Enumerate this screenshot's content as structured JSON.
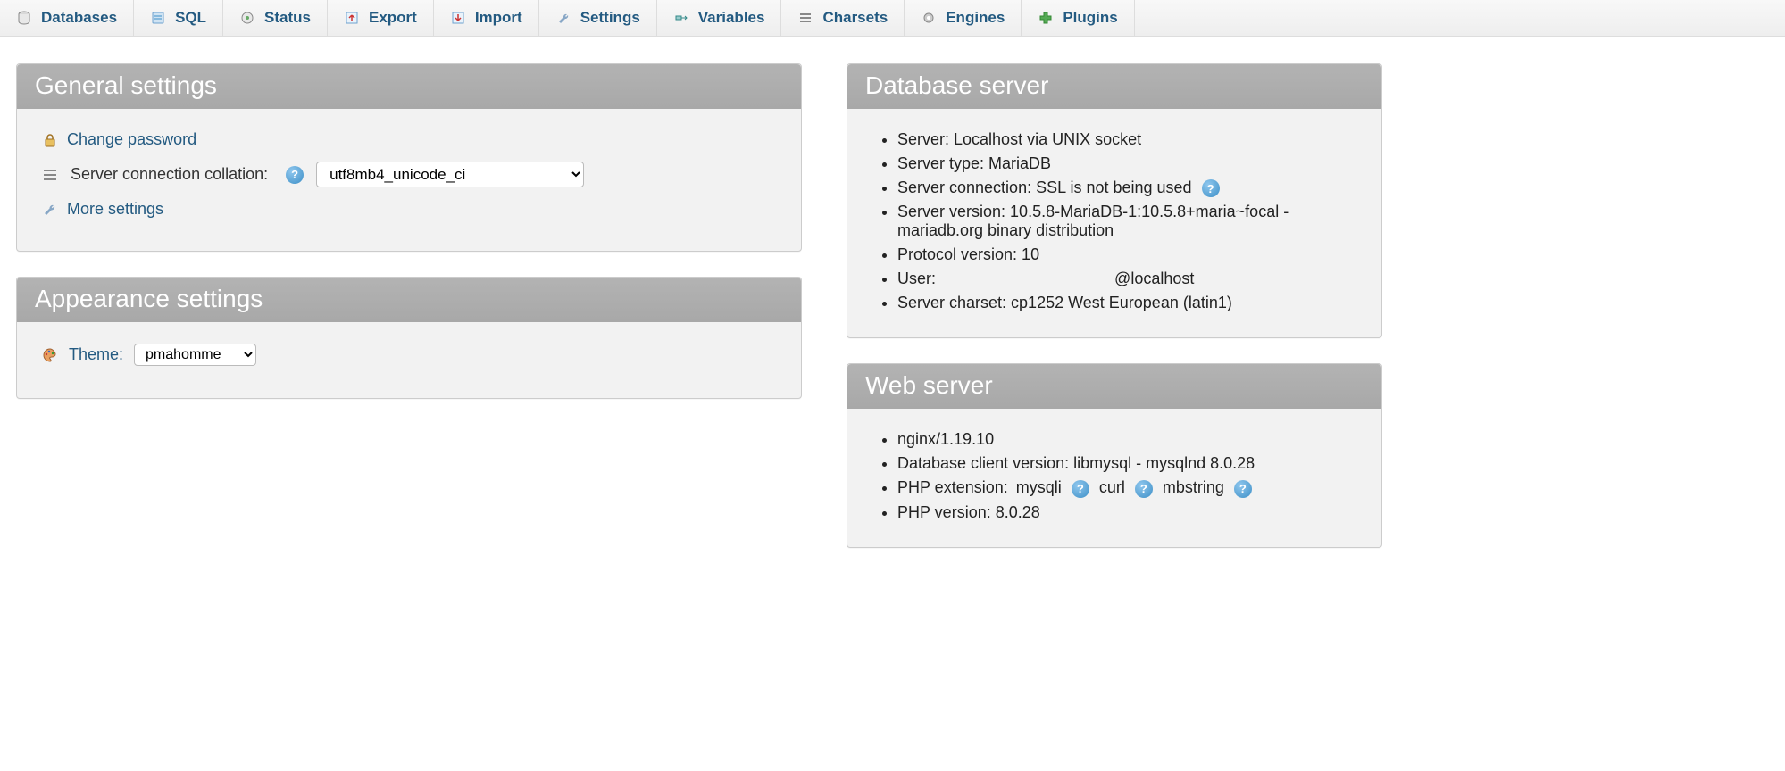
{
  "nav": {
    "databases": "Databases",
    "sql": "SQL",
    "status": "Status",
    "export": "Export",
    "import": "Import",
    "settings": "Settings",
    "variables": "Variables",
    "charsets": "Charsets",
    "engines": "Engines",
    "plugins": "Plugins"
  },
  "general": {
    "title": "General settings",
    "change_password": "Change password",
    "collation_label": "Server connection collation:",
    "collation_value": "utf8mb4_unicode_ci",
    "more_settings": "More settings"
  },
  "appearance": {
    "title": "Appearance settings",
    "theme_label": "Theme:",
    "theme_value": "pmahomme"
  },
  "db": {
    "title": "Database server",
    "server": "Server: Localhost via UNIX socket",
    "type": "Server type: MariaDB",
    "connection": "Server connection: SSL is not being used",
    "version": "Server version: 10.5.8-MariaDB-1:10.5.8+maria~focal - mariadb.org binary distribution",
    "protocol": "Protocol version: 10",
    "user_label": "User:",
    "user_host": "@localhost",
    "charset": "Server charset: cp1252 West European (latin1)"
  },
  "web": {
    "title": "Web server",
    "nginx": "nginx/1.19.10",
    "client": "Database client version: libmysql - mysqlnd 8.0.28",
    "php_ext_label": "PHP extension:",
    "ext1": "mysqli",
    "ext2": "curl",
    "ext3": "mbstring",
    "php_version": "PHP version: 8.0.28"
  }
}
